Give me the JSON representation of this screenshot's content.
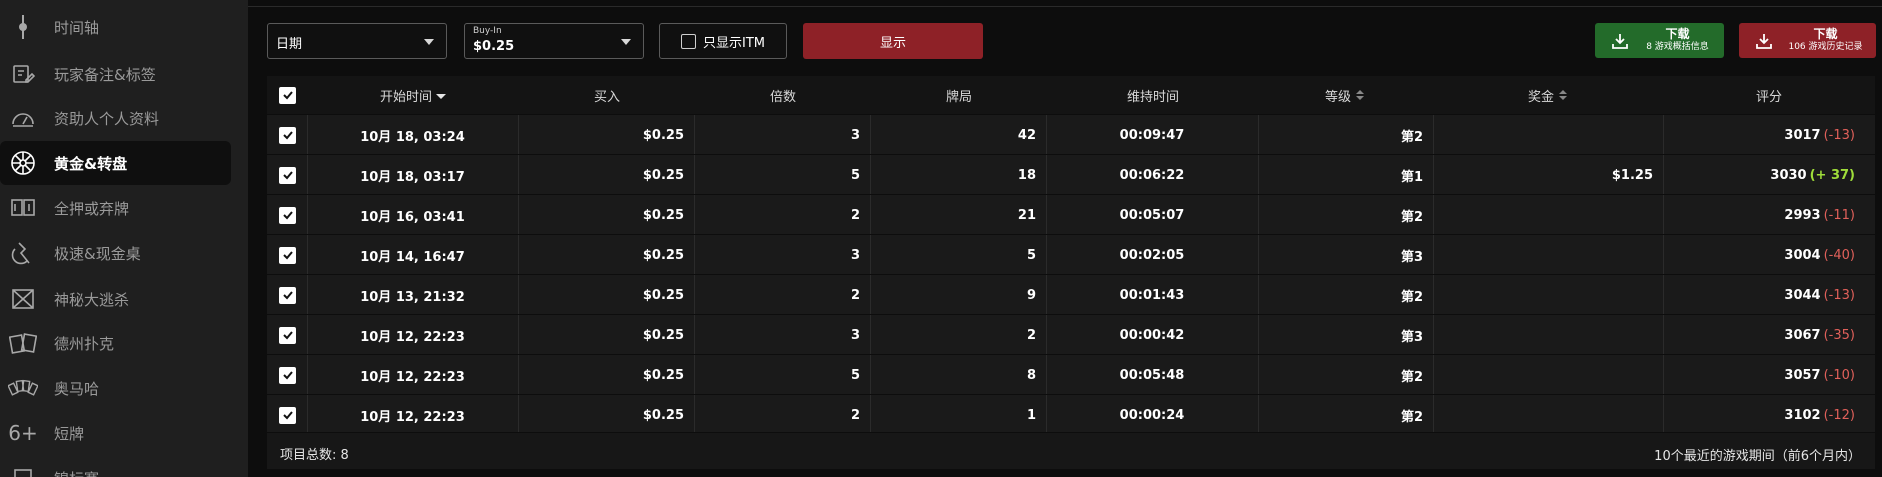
{
  "sidebar": {
    "items": [
      {
        "label": "时间轴",
        "icon": "timeline-icon"
      },
      {
        "label": "玩家备注&标签",
        "icon": "note-icon"
      },
      {
        "label": "资助人个人资料",
        "icon": "gauge-icon"
      },
      {
        "label": "黄金&转盘",
        "icon": "wheel-icon",
        "active": true
      },
      {
        "label": "全押或弃牌",
        "icon": "allin-icon"
      },
      {
        "label": "极速&现金桌",
        "icon": "speed-icon"
      },
      {
        "label": "神秘大逃杀",
        "icon": "mystery-icon"
      },
      {
        "label": "德州扑克",
        "icon": "cards-icon"
      },
      {
        "label": "奥马哈",
        "icon": "omaha-icon"
      },
      {
        "label": "短牌",
        "icon": "six-plus-icon"
      },
      {
        "label": "锦标赛",
        "icon": "trophy-icon"
      }
    ]
  },
  "filters": {
    "date": {
      "value": "日期"
    },
    "buyin": {
      "caption": "Buy-In",
      "value": "$0.25"
    },
    "itm_label": "只显示ITM",
    "show_label": "显示"
  },
  "downloads": {
    "summary": {
      "title": "下载",
      "subtitle": "8 游戏概括信息",
      "color": "#236b2a"
    },
    "history": {
      "title": "下载",
      "subtitle": "106 游戏历史记录",
      "color": "#8e2127"
    }
  },
  "table": {
    "headers": [
      "开始时间",
      "买入",
      "倍数",
      "牌局",
      "维持时间",
      "等级",
      "奖金",
      "评分"
    ],
    "rows": [
      {
        "start": "10月 18, 03:24",
        "buyin": "$0.25",
        "mult": "3",
        "hands": "42",
        "duration": "00:09:47",
        "rank": "第2",
        "prize": "",
        "score": "3017",
        "delta": "(-13)",
        "delta_type": "neg"
      },
      {
        "start": "10月 18, 03:17",
        "buyin": "$0.25",
        "mult": "5",
        "hands": "18",
        "duration": "00:06:22",
        "rank": "第1",
        "prize": "$1.25",
        "score": "3030",
        "delta": "(+ 37)",
        "delta_type": "pos"
      },
      {
        "start": "10月 16, 03:41",
        "buyin": "$0.25",
        "mult": "2",
        "hands": "21",
        "duration": "00:05:07",
        "rank": "第2",
        "prize": "",
        "score": "2993",
        "delta": "(-11)",
        "delta_type": "neg"
      },
      {
        "start": "10月 14, 16:47",
        "buyin": "$0.25",
        "mult": "3",
        "hands": "5",
        "duration": "00:02:05",
        "rank": "第3",
        "prize": "",
        "score": "3004",
        "delta": "(-40)",
        "delta_type": "neg"
      },
      {
        "start": "10月 13, 21:32",
        "buyin": "$0.25",
        "mult": "2",
        "hands": "9",
        "duration": "00:01:43",
        "rank": "第2",
        "prize": "",
        "score": "3044",
        "delta": "(-13)",
        "delta_type": "neg"
      },
      {
        "start": "10月 12, 22:23",
        "buyin": "$0.25",
        "mult": "3",
        "hands": "2",
        "duration": "00:00:42",
        "rank": "第3",
        "prize": "",
        "score": "3067",
        "delta": "(-35)",
        "delta_type": "neg"
      },
      {
        "start": "10月 12, 22:23",
        "buyin": "$0.25",
        "mult": "5",
        "hands": "8",
        "duration": "00:05:48",
        "rank": "第2",
        "prize": "",
        "score": "3057",
        "delta": "(-10)",
        "delta_type": "neg"
      },
      {
        "start": "10月 12, 22:23",
        "buyin": "$0.25",
        "mult": "2",
        "hands": "1",
        "duration": "00:00:24",
        "rank": "第2",
        "prize": "",
        "score": "3102",
        "delta": "(-12)",
        "delta_type": "neg"
      }
    ],
    "footer_left": "项目总数: 8",
    "footer_right": "10个最近的游戏期间（前6个月内）"
  },
  "colors": {
    "accent_red": "#8e2127",
    "accent_green": "#236b2a",
    "positive": "#9fdd3a",
    "negative": "#e0605a"
  }
}
